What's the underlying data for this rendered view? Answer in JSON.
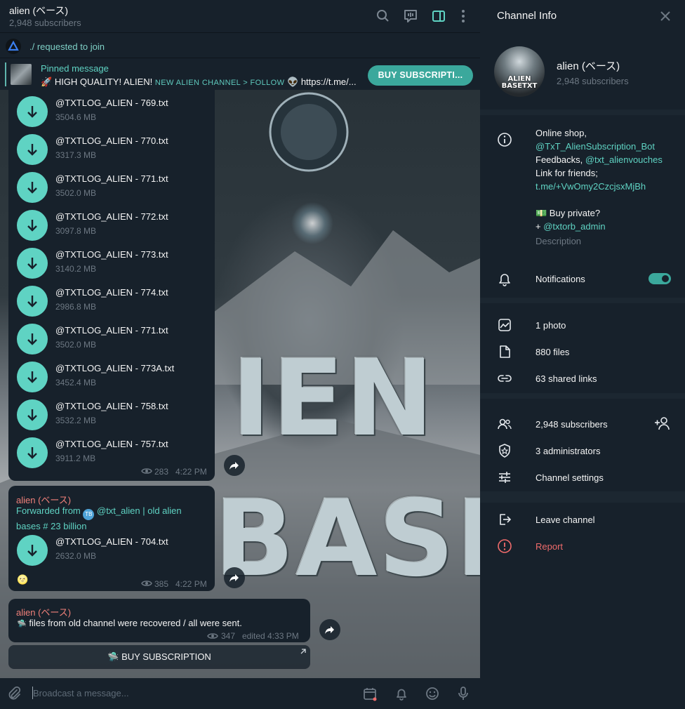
{
  "header": {
    "title": "alien (ベース)",
    "subscribers": "2,948 subscribers",
    "icons": [
      "search-icon",
      "live-stream-icon",
      "sidebar-toggle-icon",
      "more-vertical-icon"
    ]
  },
  "join_bar": {
    "text": "./ requested to join"
  },
  "pinned": {
    "title": "Pinned message",
    "text_main": "HIGH QUALITY! ALIEN!",
    "text_small": "NEW ALIEN CHANNEL > FOLLOW",
    "text_link": "https://t.me/...",
    "button": "BUY SUBSCRIPTI..."
  },
  "background_logo": {
    "line1": "IEN",
    "line2": "BASE"
  },
  "messages": [
    {
      "files": [
        {
          "name": "@TXTLOG_ALIEN - 769.txt",
          "size": "3504.6 MB"
        },
        {
          "name": "@TXTLOG_ALIEN - 770.txt",
          "size": "3317.3 MB"
        },
        {
          "name": "@TXTLOG_ALIEN - 771.txt",
          "size": "3502.0 MB"
        },
        {
          "name": "@TXTLOG_ALIEN - 772.txt",
          "size": "3097.8 MB"
        },
        {
          "name": "@TXTLOG_ALIEN - 773.txt",
          "size": "3140.2 MB"
        },
        {
          "name": "@TXTLOG_ALIEN - 774.txt",
          "size": "2986.8 MB"
        },
        {
          "name": "@TXTLOG_ALIEN - 771.txt",
          "size": "3502.0 MB"
        },
        {
          "name": "@TXTLOG_ALIEN - 773A.txt",
          "size": "3452.4 MB"
        },
        {
          "name": "@TXTLOG_ALIEN - 758.txt",
          "size": "3532.2 MB"
        },
        {
          "name": "@TXTLOG_ALIEN - 757.txt",
          "size": "3911.2 MB"
        }
      ],
      "views": "283",
      "time": "4:22 PM"
    },
    {
      "sender": "alien (ベース)",
      "forwarded_prefix": "Forwarded from",
      "forwarded_from": "@txt_alien | old alien bases # 23 billion",
      "forwarded_line1": "@txt_alien | old alien",
      "forwarded_line2": "bases # 23 billion",
      "files": [
        {
          "name": "@TXTLOG_ALIEN - 704.txt",
          "size": "2632.0 MB"
        }
      ],
      "reaction": "🌝",
      "views": "385",
      "time": "4:22 PM"
    },
    {
      "sender": "alien (ベース)",
      "text": "files from old channel were recovered / all were sent.",
      "views": "347",
      "time": "edited 4:33 PM",
      "button": "BUY SUBSCRIPTION"
    }
  ],
  "composer": {
    "placeholder": "Broadcast a message..."
  },
  "info": {
    "title": "Channel Info",
    "channel_name": "alien (ベース)",
    "subscribers": "2,948 subscribers",
    "avatar_text": "ALIEN BASETXT",
    "description": {
      "line1": "Online shop,",
      "line2": "@TxT_AlienSubscription_Bot",
      "line3_prefix": "Feedbacks,",
      "line3_link": "@txt_alienvouches",
      "line4": "Link for friends;",
      "line5": "t.me/+VwOmy2CzcjsxMjBh",
      "line6": "💵 Buy private?",
      "line7_prefix": "+",
      "line7_link": "@txtorb_admin",
      "label": "Description"
    },
    "notifications_label": "Notifications",
    "notifications_on": true,
    "media": {
      "photos": "1 photo",
      "files": "880 files",
      "links": "63 shared links"
    },
    "admin": {
      "subscribers": "2,948 subscribers",
      "administrators": "3 administrators",
      "settings": "Channel settings"
    },
    "actions": {
      "leave": "Leave channel",
      "report": "Report"
    }
  },
  "colors": {
    "accent": "#5fd3c3",
    "button": "#3ba89c",
    "panel": "#17212b",
    "muted": "#6d7883",
    "danger": "#ef6b6b",
    "sender": "#f0807a"
  }
}
